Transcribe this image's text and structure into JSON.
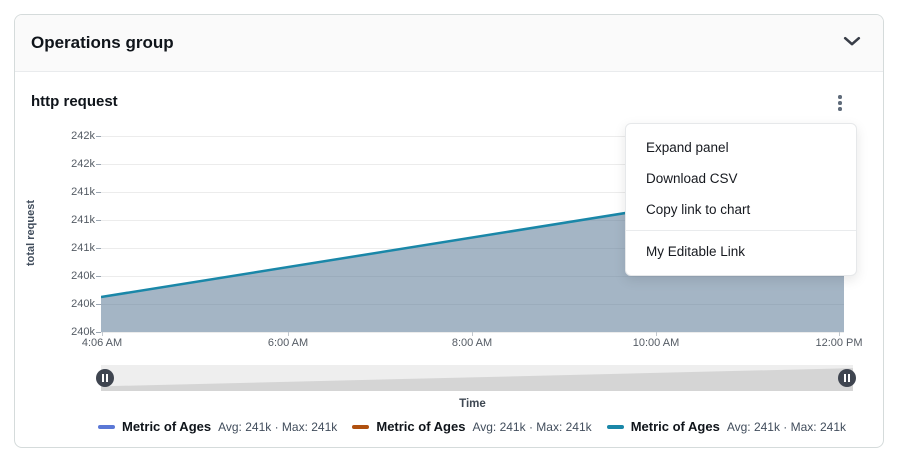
{
  "group_header": {
    "title": "Operations group"
  },
  "panel": {
    "title": "http request"
  },
  "menu": {
    "items": [
      "Expand panel",
      "Download CSV",
      "Copy link to chart",
      "My Editable Link"
    ]
  },
  "chart_data": {
    "type": "area",
    "title": "http request",
    "xlabel": "Time",
    "ylabel": "total request",
    "grid": true,
    "legend_position": "bottom",
    "x_ticks": [
      "4:06 AM",
      "6:00 AM",
      "8:00 AM",
      "10:00 AM",
      "12:00 PM"
    ],
    "y_ticks_top_to_bottom": [
      "242k",
      "242k",
      "241k",
      "241k",
      "241k",
      "240k",
      "240k",
      "240k"
    ],
    "ylim_approx": [
      239900,
      242100
    ],
    "series": [
      {
        "name": "Metric of Ages",
        "color": "#5b78d6",
        "stats": "Avg: 241k · Max: 241k",
        "avg": "241k",
        "max": "241k"
      },
      {
        "name": "Metric of Ages",
        "color": "#b0500f",
        "stats": "Avg: 241k · Max: 241k",
        "avg": "241k",
        "max": "241k"
      },
      {
        "name": "Metric of Ages",
        "color": "#1a87a8",
        "stats": "Avg: 241k · Max: 241k",
        "avg": "241k",
        "max": "241k",
        "shape": "linear-rising-area",
        "x_approx": [
          "4:06 AM",
          "12:00 PM"
        ],
        "values_approx": [
          240100,
          241600
        ]
      }
    ]
  },
  "time_slider": {
    "left_handle": "pause",
    "right_handle": "pause"
  }
}
